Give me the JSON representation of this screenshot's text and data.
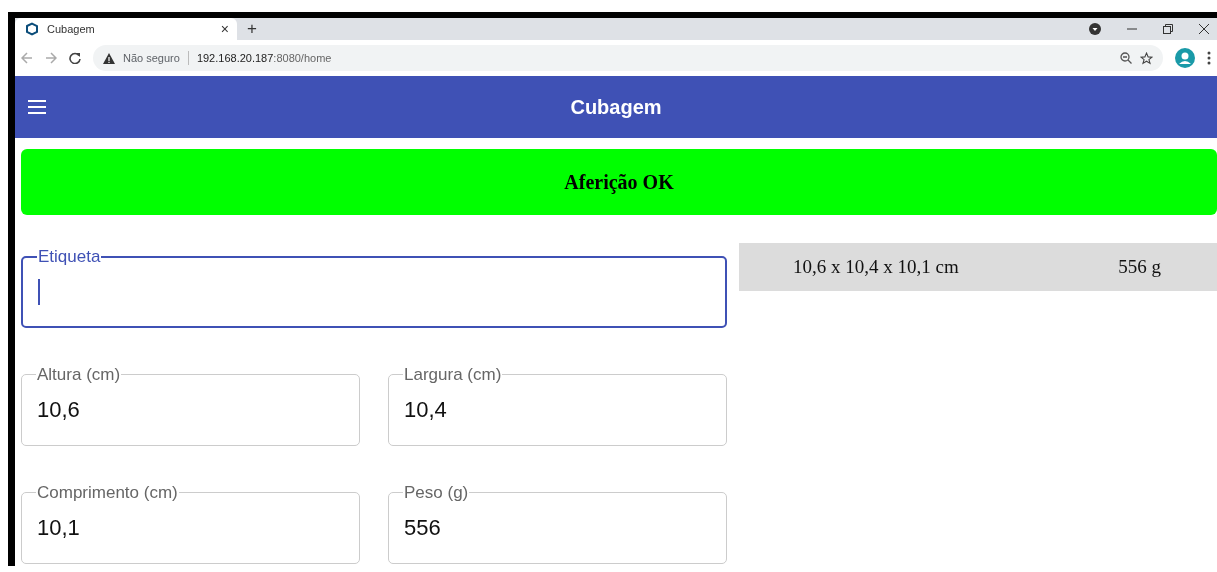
{
  "browser": {
    "tab_title": "Cubagem",
    "tab_close": "×",
    "new_tab": "+",
    "security": "Não seguro",
    "url_host": "192.168.20.187",
    "url_rest": ":8080/home"
  },
  "app_bar": {
    "title": "Cubagem"
  },
  "status": {
    "text": "Aferição OK",
    "color": "#00ff00"
  },
  "label_field": {
    "label": "Etiqueta",
    "focused": true
  },
  "fields": [
    {
      "label": "Altura (cm)",
      "value": "10,6",
      "focused": false
    },
    {
      "label": "Largura (cm)",
      "value": "10,4",
      "focused": false
    },
    {
      "label": "Comprimento (cm)",
      "value": "10,1",
      "focused": false
    },
    {
      "label": "Peso (g)",
      "value": "556",
      "focused": false
    }
  ],
  "result": {
    "dimensions": "10,6 x 10,4 x 10,1 cm",
    "weight": "556 g"
  }
}
